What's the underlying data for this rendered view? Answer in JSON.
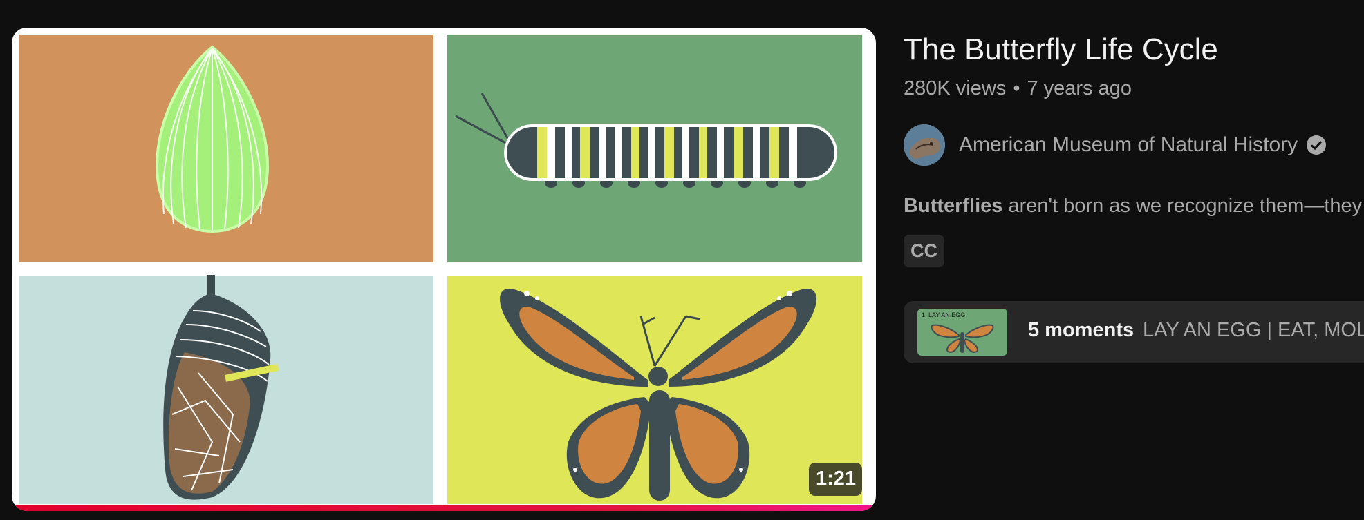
{
  "video": {
    "title": "The Butterfly Life Cycle",
    "views": "280K views",
    "age": "7 years ago",
    "duration": "1:21",
    "progress_fraction": 1.0,
    "channel_name": "American Museum of Natural History",
    "description_bold": "Butterflies",
    "description_rest": " aren't born as we recognize them—they",
    "cc_badge": "CC",
    "moments_count": "5 moments",
    "moments_chapters": "LAY AN EGG | EAT, MOLT",
    "moments_thumb_label": "1. LAY AN EGG",
    "icons": {
      "verified": "verified-check-icon",
      "avatar": "channel-avatar"
    },
    "colors": {
      "background": "#0f0f0f",
      "progress": "#e1002d",
      "panel_orange": "#d1925c",
      "panel_green": "#6ea676",
      "panel_pale": "#c5dfdc",
      "panel_yellow": "#dfe657"
    }
  }
}
